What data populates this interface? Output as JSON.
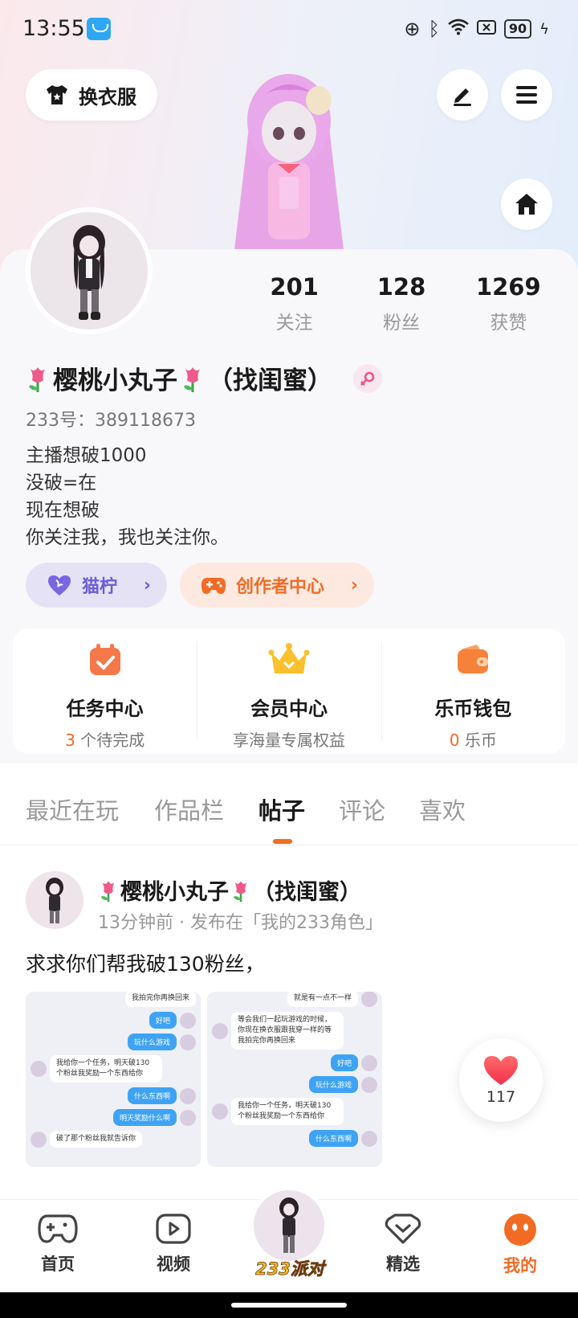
{
  "status_bar": {
    "time": "13:55",
    "battery": "90"
  },
  "header": {
    "dress_button_label": "换衣服"
  },
  "profile": {
    "stats": [
      {
        "value": "201",
        "label": "关注"
      },
      {
        "value": "128",
        "label": "粉丝"
      },
      {
        "value": "1269",
        "label": "获赞"
      }
    ],
    "nickname": "樱桃小丸子",
    "nickname_suffix": "（找闺蜜）",
    "id_line": "233号：389118673",
    "bio": [
      "主播想破1000",
      "没破=在",
      "现在想破",
      "你关注我，我也关注你。"
    ],
    "pills": {
      "cat_label": "猫柠",
      "creator_label": "创作者中心"
    }
  },
  "services": [
    {
      "title": "任务中心",
      "count": "3",
      "sub": "个待完成"
    },
    {
      "title": "会员中心",
      "count": "",
      "sub": "享海量专属权益"
    },
    {
      "title": "乐币钱包",
      "count": "0",
      "sub": "乐币"
    }
  ],
  "tabs": [
    "最近在玩",
    "作品栏",
    "帖子",
    "评论",
    "喜欢"
  ],
  "active_tab": "帖子",
  "post": {
    "author": "樱桃小丸子",
    "author_suffix": "（找闺蜜）",
    "meta": "13分钟前 · 发布在「我的233角色」",
    "text": "求求你们帮我破130粉丝，",
    "image1_chat": [
      {
        "side": "right",
        "text": "我拍完你再换回来"
      },
      {
        "side": "right",
        "text": "好吧"
      },
      {
        "side": "right",
        "text": "玩什么游戏"
      },
      {
        "side": "left",
        "text": "我给你一个任务，明天破130个粉丝我奖励一个东西给你"
      },
      {
        "side": "right",
        "text": "什么东西啊"
      },
      {
        "side": "right",
        "text": "明天奖励什么啊"
      },
      {
        "side": "left",
        "text": "破了那个粉丝我就告诉你"
      }
    ],
    "image2_chat": [
      {
        "side": "right",
        "text": "就是有一点不一样"
      },
      {
        "side": "left",
        "text": "等会我们一起玩游戏的时候，你现在换衣服跟我穿一样的等我拍完你再换回来"
      },
      {
        "side": "right",
        "text": "好吧"
      },
      {
        "side": "right",
        "text": "玩什么游戏"
      },
      {
        "side": "left",
        "text": "我给你一个任务，明天破130个粉丝我奖励一个东西给你"
      },
      {
        "side": "right",
        "text": "什么东西啊"
      }
    ],
    "likes": "117"
  },
  "bottom_nav": [
    {
      "label": "首页",
      "icon": "gamepad-icon"
    },
    {
      "label": "视频",
      "icon": "play-icon"
    },
    {
      "label": "233派对",
      "icon": "party-avatar"
    },
    {
      "label": "精选",
      "icon": "heart-diamond-icon"
    },
    {
      "label": "我的",
      "icon": "face-icon"
    }
  ],
  "colors": {
    "accent": "#f26b25",
    "purple": "#6b5bd6",
    "gold": "#f2b81d"
  }
}
